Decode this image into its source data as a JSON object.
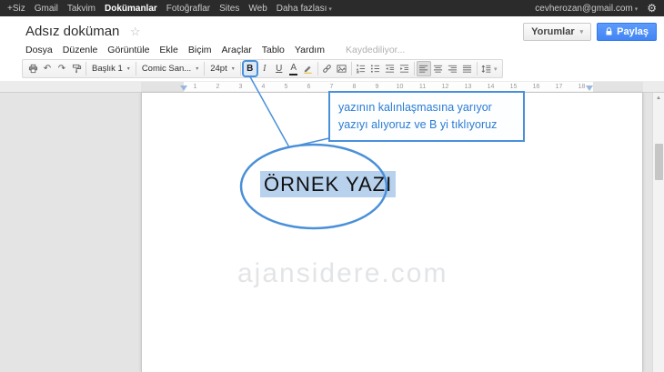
{
  "ui": {
    "caret": "▾",
    "star": "☆",
    "gear": "⚙",
    "scroll_up": "▲"
  },
  "colors": {
    "accent": "#4a90d9",
    "share_button": "#4d8ffb",
    "selection": "#b8d2ee",
    "topbar_bg": "#2b2b2b"
  },
  "topbar": {
    "links": [
      {
        "label": "+Siz"
      },
      {
        "label": "Gmail"
      },
      {
        "label": "Takvim"
      },
      {
        "label": "Dokümanlar",
        "active": true
      },
      {
        "label": "Fotoğraflar"
      },
      {
        "label": "Sites"
      },
      {
        "label": "Web"
      },
      {
        "label": "Daha fazlası",
        "caret": true
      }
    ],
    "account": "cevherozan@gmail.com"
  },
  "header": {
    "title": "Adsız doküman",
    "comments_label": "Yorumlar",
    "share_label": "Paylaş"
  },
  "menubar": {
    "items": [
      "Dosya",
      "Düzenle",
      "Görüntüle",
      "Ekle",
      "Biçim",
      "Araçlar",
      "Tablo",
      "Yardım"
    ],
    "status": "Kaydediliyor..."
  },
  "toolbar": {
    "items": [
      {
        "name": "print-icon",
        "type": "icon"
      },
      {
        "name": "undo-icon",
        "type": "icon",
        "glyph": "↶"
      },
      {
        "name": "redo-icon",
        "type": "icon",
        "glyph": "↷"
      },
      {
        "name": "paint-format-icon",
        "type": "icon"
      },
      {
        "type": "sep"
      },
      {
        "name": "styles-dropdown",
        "type": "dropdown",
        "label": "Başlık 1"
      },
      {
        "type": "sep"
      },
      {
        "name": "font-dropdown",
        "type": "dropdown",
        "label": "Comic San..."
      },
      {
        "type": "sep"
      },
      {
        "name": "font-size-dropdown",
        "type": "dropdown",
        "label": "24pt"
      },
      {
        "type": "sep"
      },
      {
        "name": "bold-button",
        "type": "icon",
        "glyph": "B",
        "active": true
      },
      {
        "name": "italic-button",
        "type": "icon",
        "glyph": "I"
      },
      {
        "name": "underline-button",
        "type": "icon",
        "glyph": "U"
      },
      {
        "name": "text-color-button",
        "type": "icon",
        "glyph": "A",
        "colorbar": true
      },
      {
        "name": "highlight-color-button",
        "type": "icon"
      },
      {
        "type": "sep"
      },
      {
        "name": "insert-link-button",
        "type": "icon"
      },
      {
        "name": "insert-image-button",
        "type": "icon"
      },
      {
        "type": "sep"
      },
      {
        "name": "numbered-list-button",
        "type": "icon"
      },
      {
        "name": "bulleted-list-button",
        "type": "icon"
      },
      {
        "name": "outdent-button",
        "type": "icon"
      },
      {
        "name": "indent-button",
        "type": "icon"
      },
      {
        "type": "sep"
      },
      {
        "name": "align-left-button",
        "type": "icon",
        "pressed": true
      },
      {
        "name": "align-center-button",
        "type": "icon"
      },
      {
        "name": "align-right-button",
        "type": "icon"
      },
      {
        "name": "align-justify-button",
        "type": "icon"
      },
      {
        "type": "sep"
      },
      {
        "name": "line-spacing-button",
        "type": "icon",
        "caret": true
      }
    ]
  },
  "ruler": {
    "numbers": [
      "1",
      "2",
      "3",
      "4",
      "5",
      "6",
      "7",
      "8",
      "9",
      "10",
      "11",
      "12",
      "13",
      "14",
      "15",
      "16",
      "17",
      "18"
    ]
  },
  "document": {
    "text": "ÖRNEK YAZI",
    "watermark": "ajansidere.com"
  },
  "annotation": {
    "line1": "yazının kalınlaşmasına yarıyor",
    "line2": "yazıyı alıyoruz ve B yi tıklıyoruz"
  }
}
